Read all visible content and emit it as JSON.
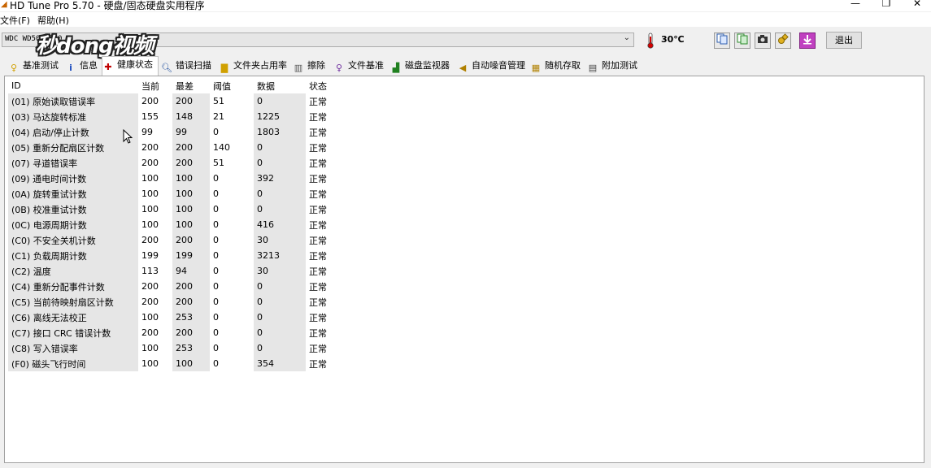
{
  "window": {
    "title": "HD Tune Pro 5.70 - 硬盘/固态硬盘实用程序",
    "minimize": "—",
    "restore": "❐",
    "close": "✕"
  },
  "menu": [
    {
      "label": "文件(F)"
    },
    {
      "label": "帮助(H)"
    }
  ],
  "drive": {
    "selected": "WDC WD50          (500",
    "temperature": "30℃",
    "exit_label": "退出"
  },
  "watermark": "秒dong视频",
  "toolbar_icons": [
    "copy-text-icon",
    "copy-screenshot-icon",
    "camera-icon",
    "options-icon",
    "save-icon"
  ],
  "tabs": [
    {
      "label": "基准测试",
      "icon": "benchmark-icon"
    },
    {
      "label": "信息",
      "icon": "info-icon"
    },
    {
      "label": "健康状态",
      "icon": "health-icon",
      "active": true
    },
    {
      "label": "错误扫描",
      "icon": "error-scan-icon"
    },
    {
      "label": "文件夹占用率",
      "icon": "folder-usage-icon"
    },
    {
      "label": "擦除",
      "icon": "erase-icon"
    },
    {
      "label": "文件基准",
      "icon": "file-benchmark-icon"
    },
    {
      "label": "磁盘监视器",
      "icon": "disk-monitor-icon"
    },
    {
      "label": "自动噪音管理",
      "icon": "aam-icon"
    },
    {
      "label": "随机存取",
      "icon": "random-access-icon"
    },
    {
      "label": "附加测试",
      "icon": "extra-tests-icon"
    }
  ],
  "table": {
    "headers": [
      "ID",
      "当前",
      "最差",
      "阈值",
      "数据",
      "状态"
    ],
    "rows": [
      [
        "(01) 原始读取错误率",
        "200",
        "200",
        "51",
        "0",
        "正常"
      ],
      [
        "(03) 马达旋转标准",
        "155",
        "148",
        "21",
        "1225",
        "正常"
      ],
      [
        "(04) 启动/停止计数",
        "99",
        "99",
        "0",
        "1803",
        "正常"
      ],
      [
        "(05) 重新分配扇区计数",
        "200",
        "200",
        "140",
        "0",
        "正常"
      ],
      [
        "(07) 寻道错误率",
        "200",
        "200",
        "51",
        "0",
        "正常"
      ],
      [
        "(09) 通电时间计数",
        "100",
        "100",
        "0",
        "392",
        "正常"
      ],
      [
        "(0A) 旋转重试计数",
        "100",
        "100",
        "0",
        "0",
        "正常"
      ],
      [
        "(0B) 校准重试计数",
        "100",
        "100",
        "0",
        "0",
        "正常"
      ],
      [
        "(0C) 电源周期计数",
        "100",
        "100",
        "0",
        "416",
        "正常"
      ],
      [
        "(C0) 不安全关机计数",
        "200",
        "200",
        "0",
        "30",
        "正常"
      ],
      [
        "(C1) 负载周期计数",
        "199",
        "199",
        "0",
        "3213",
        "正常"
      ],
      [
        "(C2) 温度",
        "113",
        "94",
        "0",
        "30",
        "正常"
      ],
      [
        "(C4) 重新分配事件计数",
        "200",
        "200",
        "0",
        "0",
        "正常"
      ],
      [
        "(C5) 当前待映射扇区计数",
        "200",
        "200",
        "0",
        "0",
        "正常"
      ],
      [
        "(C6) 离线无法校正",
        "100",
        "253",
        "0",
        "0",
        "正常"
      ],
      [
        "(C7) 接口 CRC 错误计数",
        "200",
        "200",
        "0",
        "0",
        "正常"
      ],
      [
        "(C8) 写入错误率",
        "100",
        "253",
        "0",
        "0",
        "正常"
      ],
      [
        "(F0) 磁头飞行时间",
        "100",
        "100",
        "0",
        "354",
        "正常"
      ]
    ]
  }
}
